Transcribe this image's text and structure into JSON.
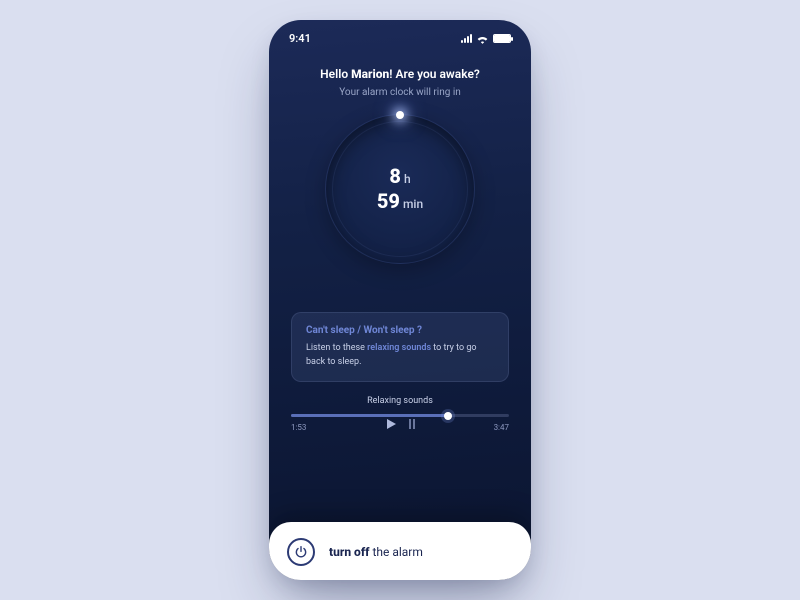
{
  "statusbar": {
    "time": "9:41"
  },
  "header": {
    "hello": "Hello ",
    "name": "Marion",
    "rest": "! Are you awake?",
    "sub": "Your alarm clock will ring in"
  },
  "clock": {
    "hours_num": "8",
    "hours_unit": "h",
    "mins_num": "59",
    "mins_unit": "min"
  },
  "card": {
    "title": "Can't sleep / Won't sleep ?",
    "body_pre": "Listen to these ",
    "body_hl": "relaxing sounds",
    "body_post": " to try to go back to sleep."
  },
  "player": {
    "title": "Relaxing sounds",
    "elapsed": "1:53",
    "total": "3:47"
  },
  "bottom": {
    "bold": "turn off",
    "rest": " the alarm"
  }
}
